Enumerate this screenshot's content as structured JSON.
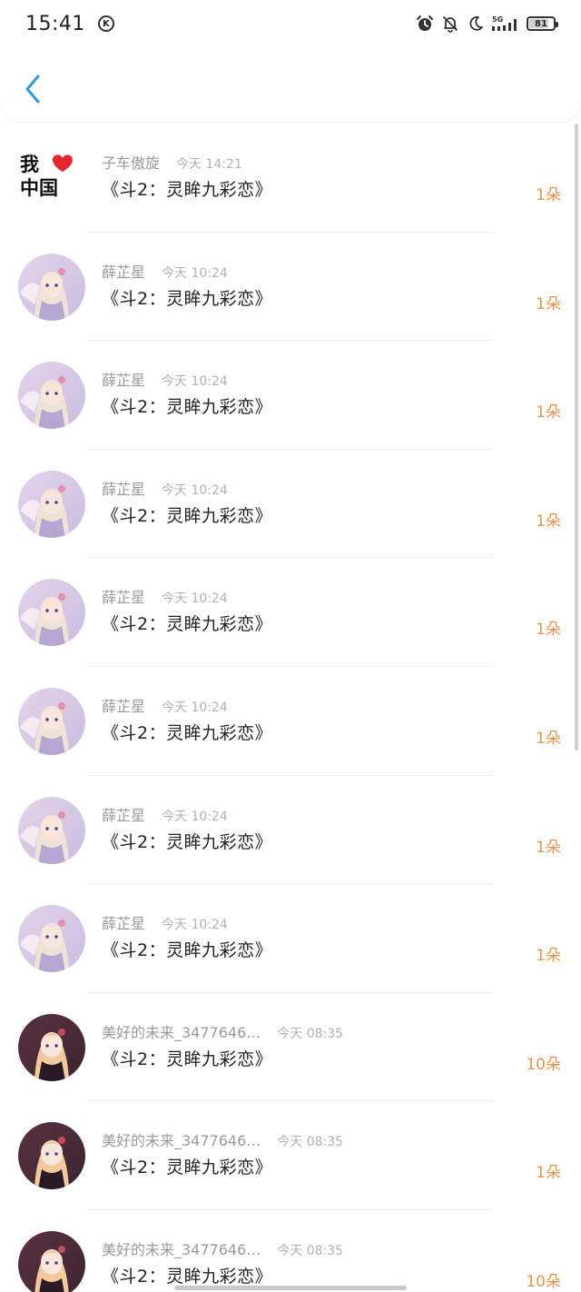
{
  "status_bar": {
    "time": "15:41",
    "k_badge": "K",
    "network": "5G",
    "battery": "81",
    "battery_level_percent": 81,
    "icons": [
      "alarm-icon",
      "bell-off-icon",
      "moon-icon",
      "signal-icon",
      "battery-icon"
    ]
  },
  "header": {
    "back_icon": "chevron-left-icon",
    "accent_color": "#2a9be0"
  },
  "list": {
    "items": [
      {
        "avatar": "love-china-logo",
        "username": "子车傲旋",
        "time": "今天 14:21",
        "title": "《斗2：灵眸九彩恋》",
        "count": "1朵"
      },
      {
        "avatar": "anime-girl-fan",
        "username": "薛芷星",
        "time": "今天 10:24",
        "title": "《斗2：灵眸九彩恋》",
        "count": "1朵"
      },
      {
        "avatar": "anime-girl-fan",
        "username": "薛芷星",
        "time": "今天 10:24",
        "title": "《斗2：灵眸九彩恋》",
        "count": "1朵"
      },
      {
        "avatar": "anime-girl-fan",
        "username": "薛芷星",
        "time": "今天 10:24",
        "title": "《斗2：灵眸九彩恋》",
        "count": "1朵"
      },
      {
        "avatar": "anime-girl-fan",
        "username": "薛芷星",
        "time": "今天 10:24",
        "title": "《斗2：灵眸九彩恋》",
        "count": "1朵"
      },
      {
        "avatar": "anime-girl-fan",
        "username": "薛芷星",
        "time": "今天 10:24",
        "title": "《斗2：灵眸九彩恋》",
        "count": "1朵"
      },
      {
        "avatar": "anime-girl-fan",
        "username": "薛芷星",
        "time": "今天 10:24",
        "title": "《斗2：灵眸九彩恋》",
        "count": "1朵"
      },
      {
        "avatar": "anime-girl-fan",
        "username": "薛芷星",
        "time": "今天 10:24",
        "title": "《斗2：灵眸九彩恋》",
        "count": "1朵"
      },
      {
        "avatar": "anime-girl-dark",
        "username": "美好的未来_3477646…",
        "time": "今天 08:35",
        "title": "《斗2：灵眸九彩恋》",
        "count": "10朵"
      },
      {
        "avatar": "anime-girl-dark",
        "username": "美好的未来_3477646…",
        "time": "今天 08:35",
        "title": "《斗2：灵眸九彩恋》",
        "count": "1朵"
      },
      {
        "avatar": "anime-girl-dark",
        "username": "美好的未来_3477646…",
        "time": "今天 08:35",
        "title": "《斗2：灵眸九彩恋》",
        "count": "10朵"
      }
    ]
  },
  "colors": {
    "count": "#e8944a",
    "username": "#9a9a9a",
    "timestamp": "#b3b3b3",
    "title": "#222222"
  },
  "brand_logo": {
    "line1": "我",
    "line2": "中国"
  }
}
